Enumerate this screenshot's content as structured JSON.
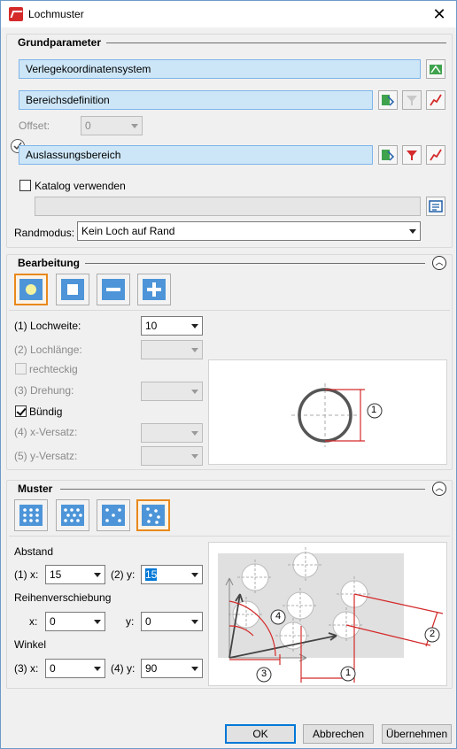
{
  "window": {
    "title": "Lochmuster",
    "close": "✕"
  },
  "grund": {
    "title": "Grundparameter",
    "verlege": "Verlegekoordinatensystem",
    "bereich": "Bereichsdefinition",
    "offset_label": "Offset:",
    "offset_value": "0",
    "auslass": "Auslassungsbereich",
    "katalog": "Katalog verwenden",
    "randmodus_label": "Randmodus:",
    "randmodus_value": "Kein Loch auf Rand"
  },
  "bearbeitung": {
    "title": "Bearbeitung",
    "tools": [
      "hole-round",
      "hole-square",
      "remove",
      "add"
    ],
    "lochweite_label": "(1) Lochweite:",
    "lochweite_value": "10",
    "lochlaenge_label": "(2) Lochlänge:",
    "rechteckig": "rechteckig",
    "drehung_label": "(3) Drehung:",
    "buendig": "Bündig",
    "xversatz_label": "(4) x-Versatz:",
    "yversatz_label": "(5) y-Versatz:",
    "preview_marker": "1"
  },
  "muster": {
    "title": "Muster",
    "abstand": "Abstand",
    "x1_label": "(1) x:",
    "x1_value": "15",
    "y2_label": "(2) y:",
    "y2_value": "15",
    "reihen": "Reihenverschiebung",
    "rx_label": "x:",
    "rx_value": "0",
    "ry_label": "y:",
    "ry_value": "0",
    "winkel": "Winkel",
    "wx_label": "(3) x:",
    "wx_value": "0",
    "wy_label": "(4) y:",
    "wy_value": "90",
    "markers": [
      "1",
      "2",
      "3",
      "4"
    ]
  },
  "footer": {
    "ok": "OK",
    "cancel": "Abbrechen",
    "apply": "Übernehmen"
  },
  "colors": {
    "accent": "#4d95d8",
    "selected_border": "#e8891c",
    "field_bg": "#cde6f7",
    "red": "#d42a2a"
  }
}
